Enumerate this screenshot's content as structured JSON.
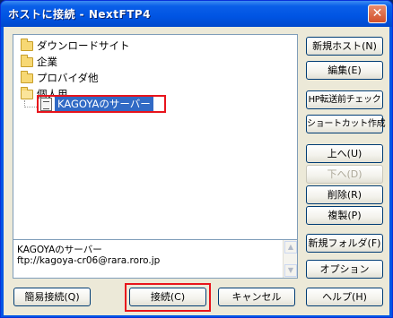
{
  "window": {
    "title": "ホストに接続 - NextFTP4",
    "close_glyph": "✕"
  },
  "tree": {
    "folders": [
      {
        "label": "ダウンロードサイト",
        "open": false
      },
      {
        "label": "企業",
        "open": false
      },
      {
        "label": "プロバイダ他",
        "open": false
      },
      {
        "label": "個人用",
        "open": true
      }
    ],
    "selected_site": "KAGOYAのサーバー"
  },
  "info": {
    "name": "KAGOYAのサーバー",
    "url": "ftp://kagoya-cr06@rara.roro.jp"
  },
  "buttons": {
    "new_host": "新規ホスト(N)",
    "edit": "編集(E)",
    "hp_check": "HP転送前チェック",
    "shortcut": "ショートカット作成",
    "up": "上へ(U)",
    "down": "下へ(D)",
    "delete": "削除(R)",
    "copy": "複製(P)",
    "new_folder": "新規フォルダ(F)",
    "options": "オプション",
    "quick_connect": "簡易接続(Q)",
    "connect": "接続(C)",
    "cancel": "キャンセル",
    "help": "ヘルプ(H)"
  },
  "colors": {
    "title_bar": "#0054e3",
    "selection": "#316ac5",
    "highlight_box": "#e8141c",
    "dialog_bg": "#ece9d8"
  }
}
